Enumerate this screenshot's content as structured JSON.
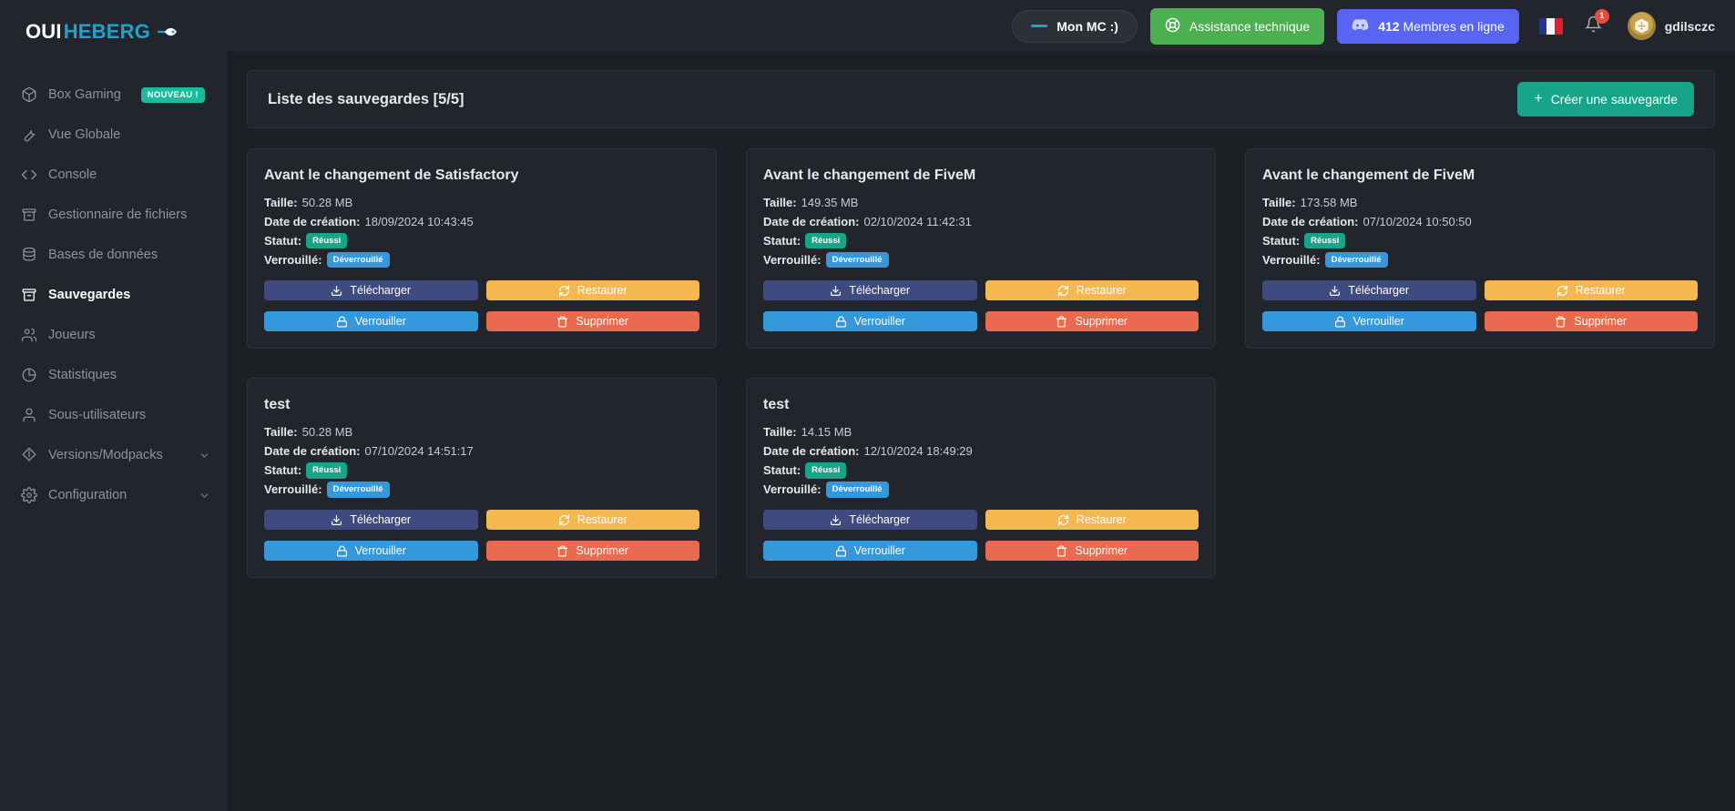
{
  "brand": {
    "part1": "OUI",
    "part2": "HEBERG",
    "rocket_icon": "rocket-icon"
  },
  "sidebar": {
    "items": [
      {
        "label": "Box Gaming",
        "icon": "box-icon",
        "badge": "NOUVEAU !",
        "active": false,
        "chevron": false
      },
      {
        "label": "Vue Globale",
        "icon": "wrench-icon",
        "badge": null,
        "active": false,
        "chevron": false
      },
      {
        "label": "Console",
        "icon": "code-icon",
        "badge": null,
        "active": false,
        "chevron": false
      },
      {
        "label": "Gestionnaire de fichiers",
        "icon": "archive-icon",
        "badge": null,
        "active": false,
        "chevron": false
      },
      {
        "label": "Bases de données",
        "icon": "database-icon",
        "badge": null,
        "active": false,
        "chevron": false
      },
      {
        "label": "Sauvegardes",
        "icon": "archive-icon",
        "badge": null,
        "active": true,
        "chevron": false
      },
      {
        "label": "Joueurs",
        "icon": "users-icon",
        "badge": null,
        "active": false,
        "chevron": false
      },
      {
        "label": "Statistiques",
        "icon": "pie-chart-icon",
        "badge": null,
        "active": false,
        "chevron": false
      },
      {
        "label": "Sous-utilisateurs",
        "icon": "user-icon",
        "badge": null,
        "active": false,
        "chevron": false
      },
      {
        "label": "Versions/Modpacks",
        "icon": "git-branch-icon",
        "badge": null,
        "active": false,
        "chevron": true
      },
      {
        "label": "Configuration",
        "icon": "gear-icon",
        "badge": null,
        "active": false,
        "chevron": true
      }
    ]
  },
  "topbar": {
    "server_pill": "Mon MC :)",
    "support_button": "Assistance technique",
    "discord_count": "412",
    "discord_label": "Membres en ligne",
    "flag": "french-flag-icon",
    "notifications_count": "1",
    "username": "gdilsczc"
  },
  "panel": {
    "title": "Liste des sauvegardes [5/5]",
    "create_button": "Créer une sauvegarde"
  },
  "labels": {
    "size": "Taille:",
    "created": "Date de création:",
    "status": "Statut:",
    "locked": "Verrouillé:",
    "download": "Télécharger",
    "restore": "Restaurer",
    "lock": "Verrouiller",
    "delete": "Supprimer"
  },
  "colors": {
    "accent": "#17a589",
    "sidebar_bg": "#22262c",
    "content_bg": "#1c2025",
    "brand_blue": "#1ba5cd",
    "status_success": "#17a589",
    "status_unlocked": "#3498db",
    "download": "#3f4a80",
    "restore": "#f5b74f",
    "lock": "#3498db",
    "delete": "#ea6a4f",
    "discord": "#5865f2",
    "support": "#4caf50"
  },
  "backups": [
    {
      "name": "Avant le changement de Satisfactory",
      "size": "50.28 MB",
      "created": "18/09/2024 10:43:45",
      "status": "Réussi",
      "locked": "Déverrouillé"
    },
    {
      "name": "Avant le changement de FiveM",
      "size": "149.35 MB",
      "created": "02/10/2024 11:42:31",
      "status": "Réussi",
      "locked": "Déverrouillé"
    },
    {
      "name": "Avant le changement de FiveM",
      "size": "173.58 MB",
      "created": "07/10/2024 10:50:50",
      "status": "Réussi",
      "locked": "Déverrouillé"
    },
    {
      "name": "test",
      "size": "50.28 MB",
      "created": "07/10/2024 14:51:17",
      "status": "Réussi",
      "locked": "Déverrouillé"
    },
    {
      "name": "test",
      "size": "14.15 MB",
      "created": "12/10/2024 18:49:29",
      "status": "Réussi",
      "locked": "Déverrouillé"
    }
  ]
}
